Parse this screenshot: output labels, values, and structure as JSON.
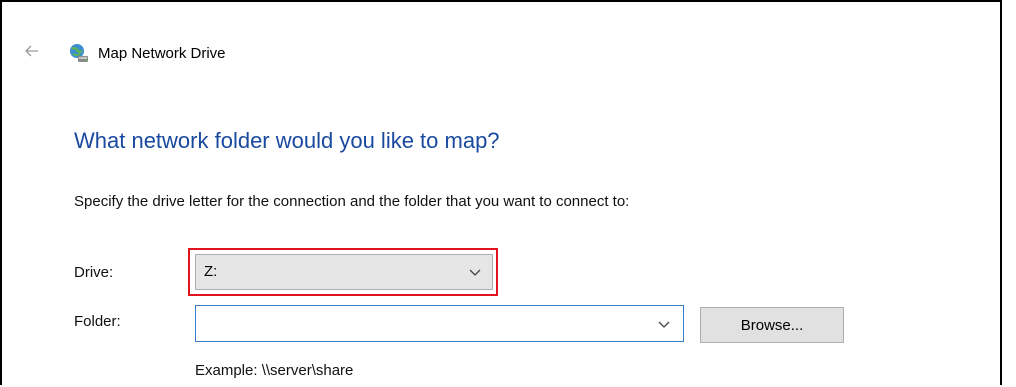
{
  "window": {
    "title": "Map Network Drive",
    "back_icon": "back-arrow-icon",
    "app_icon": "network-drive-icon"
  },
  "page": {
    "heading": "What network folder would you like to map?",
    "instruction": "Specify the drive letter for the connection and the folder that you want to connect to:"
  },
  "form": {
    "drive_label": "Drive:",
    "drive_value": "Z:",
    "folder_label": "Folder:",
    "folder_value": "",
    "browse_label": "Browse...",
    "example": "Example: \\\\server\\share"
  },
  "colors": {
    "heading": "#1a4aa0",
    "highlight": "#e0141e",
    "focus_border": "#3a7dc9"
  }
}
